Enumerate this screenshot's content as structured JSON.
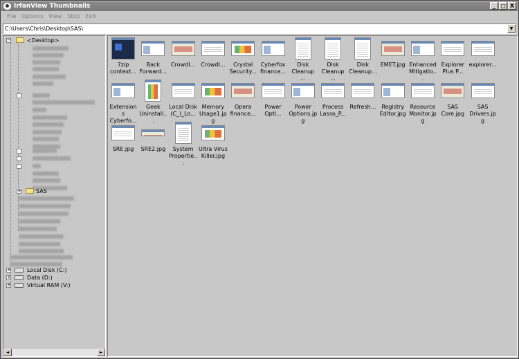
{
  "window": {
    "title": "IrfanView Thumbnails",
    "btn_min": "_",
    "btn_max": "□",
    "btn_close": "X"
  },
  "menu": [
    "File",
    "Options",
    "View",
    "Stop",
    "Exit"
  ],
  "address": "C:\\Users\\Chris\\Desktop\\SAS\\",
  "tree": {
    "root": "<Desktop>",
    "current_folder": "SAS",
    "drives": [
      "Local Disk (C:)",
      "Data (D:)",
      "Virtual RAM (V:)"
    ],
    "scroll_left": "◄",
    "scroll_right": "►"
  },
  "thumbnails": [
    [
      "7zip",
      "context..."
    ],
    [
      "Back",
      "Forward..."
    ],
    [
      "CrowdI..."
    ],
    [
      "CrowdI..."
    ],
    [
      "Crystal",
      "Security..."
    ],
    [
      "Cyberfox",
      "finance..."
    ],
    [
      "Disk",
      "Cleanup ..."
    ],
    [
      "Disk",
      "Cleanup ..."
    ],
    [
      "Disk",
      "Cleanup..."
    ],
    [
      "EMET.jpg"
    ],
    [
      "Enhanced",
      "Mitigatio..."
    ],
    [
      "Explorer",
      "Plus P..."
    ],
    [
      "explorer..."
    ],
    [
      "Extensions",
      "Cyberfo..."
    ],
    [
      "Geek",
      "Uninstall..."
    ],
    [
      "Local Disk",
      "(C_)_Lo..."
    ],
    [
      "Memory",
      "Usage1.jpg"
    ],
    [
      "Opera",
      "finance..."
    ],
    [
      "Power",
      "Opti..."
    ],
    [
      "Power",
      "Options.jpg"
    ],
    [
      "Process",
      "Lasso_P..."
    ],
    [
      "Refresh..."
    ],
    [
      "Registry",
      "Editor.jpg"
    ],
    [
      "Resource",
      "Monitor.jpg"
    ],
    [
      "SAS",
      "Core.jpg"
    ],
    [
      "SAS",
      "Drivers.jpg"
    ],
    [
      "SRE.jpg"
    ],
    [
      "SRE2.jpg"
    ],
    [
      "System",
      "Propertie..."
    ],
    [
      "Ultra Virus",
      "Killer.jpg"
    ]
  ]
}
